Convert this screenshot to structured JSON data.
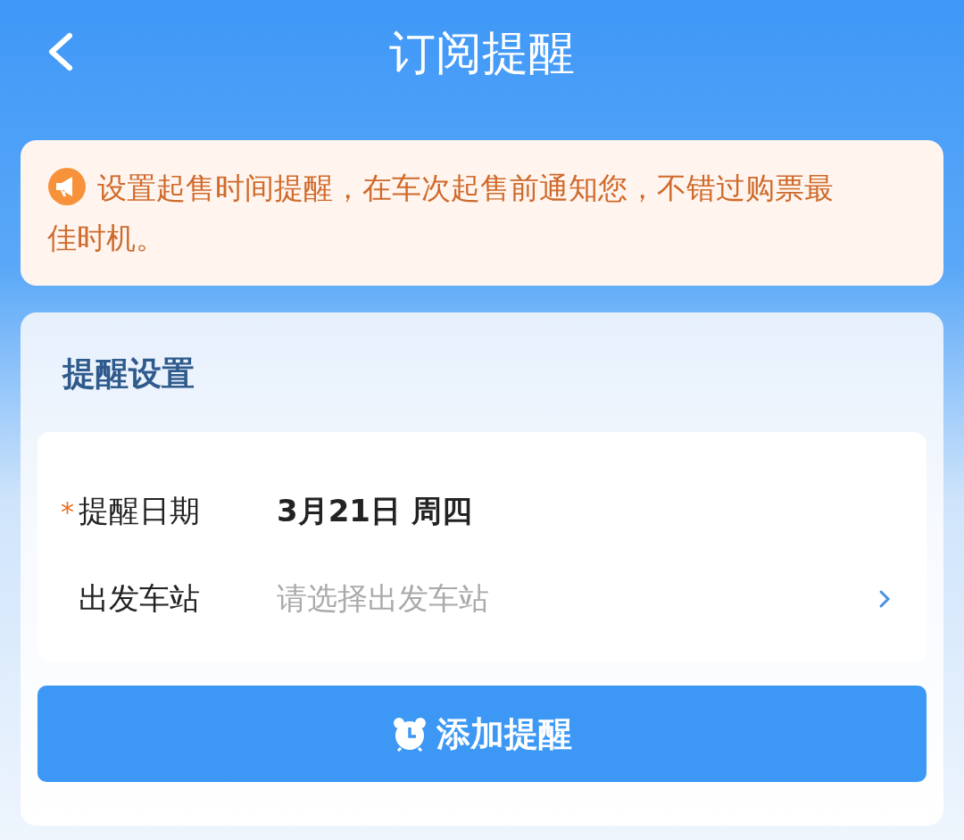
{
  "header": {
    "title": "订阅提醒"
  },
  "notice": {
    "text": "设置起售时间提醒，在车次起售前通知您，不错过购票最佳时机。"
  },
  "settings": {
    "title": "提醒设置",
    "fields": [
      {
        "kind": "value",
        "required_mark": "*",
        "label": "提醒日期",
        "value": "3月21日 周四"
      },
      {
        "kind": "select",
        "label": "出发车站",
        "placeholder": "请选择出发车站"
      }
    ],
    "button": {
      "label": "添加提醒"
    }
  }
}
